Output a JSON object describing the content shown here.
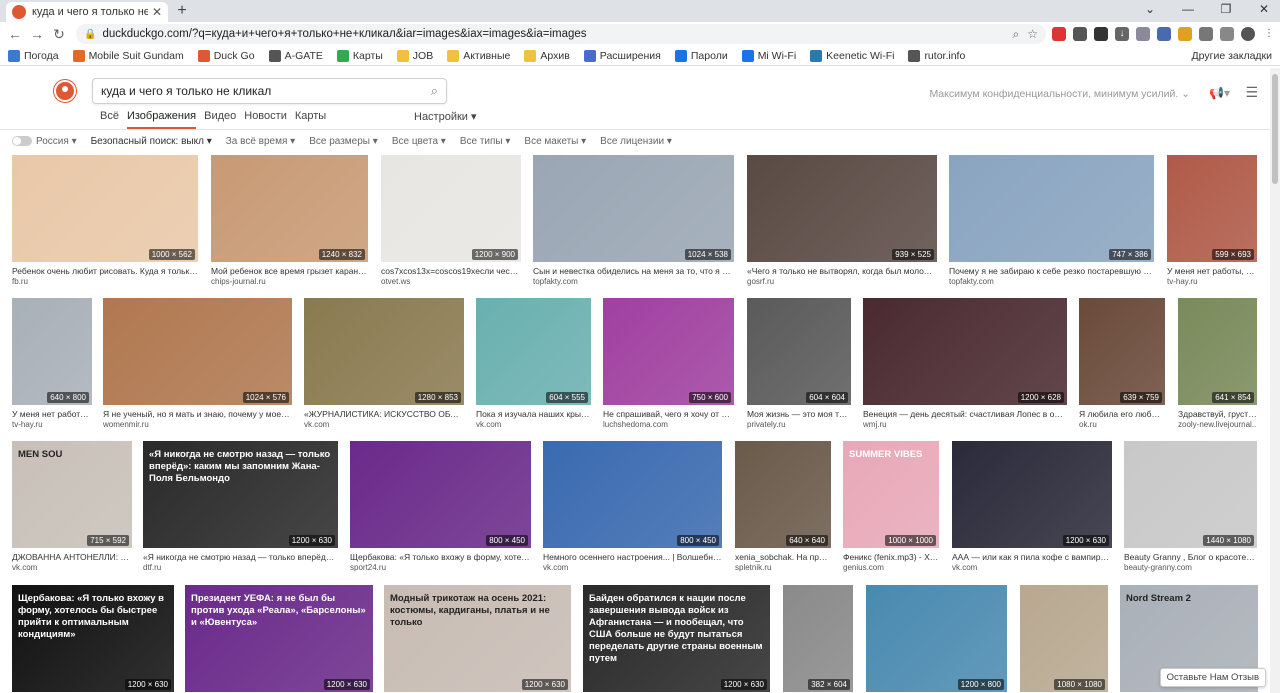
{
  "browser": {
    "tab_title": "куда и чего я только не кликал",
    "url": "duckduckgo.com/?q=куда+и+чего+я+только+не+кликал&iar=images&iax=images&ia=images",
    "bookmarks": [
      "Погода",
      "Mobile Suit Gundam",
      "Duck Go",
      "A-GATE",
      "Карты",
      "JOB",
      "Активные",
      "Архив",
      "Расширения",
      "Пароли",
      "Mi Wi-Fi",
      "Keenetic Wi-Fi",
      "rutor.info"
    ],
    "other_bookmarks": "Другие закладки"
  },
  "search": {
    "query": "куда и чего я только не кликал",
    "tabs": [
      "Всё",
      "Изображения",
      "Видео",
      "Новости",
      "Карты"
    ],
    "active_tab": "Изображения",
    "settings": "Настройки",
    "privacy_slogan": "Максимум конфиденциальности, минимум усилий."
  },
  "filters": {
    "region": "Россия",
    "safe_search": "Безопасный поиск: выкл",
    "items": [
      "За всё время",
      "Все размеры",
      "Все цвета",
      "Все типы",
      "Все макеты",
      "Все лицензии"
    ]
  },
  "results": [
    {
      "cap": "Ребенок очень любит рисовать. Куда я только не...",
      "src": "fb.ru",
      "size": "1000 × 562",
      "color": "#e9c8a8"
    },
    {
      "cap": "Мой ребенок все время грызет каранда...",
      "src": "chips-journal.ru",
      "size": "1240 × 832",
      "color": "#c89a74"
    },
    {
      "cap": "cos7xcos13x=coscos19xесли честно ...",
      "src": "otvet.ws",
      "size": "1200 × 900",
      "color": "#e8e6e2"
    },
    {
      "cap": "Сын и невестка обиделись на меня за то, что я не от...",
      "src": "topfakty.com",
      "size": "1024 × 538",
      "color": "#9aa6b4"
    },
    {
      "cap": "«Чего я только не вытворял, когда был молодым»...",
      "src": "gosrf.ru",
      "size": "939 × 525",
      "color": "#5a4a44"
    },
    {
      "cap": "Почему я не забираю к себе резко постаревшую род...",
      "src": "topfakty.com",
      "size": "747 × 386",
      "color": "#8aa4c0"
    },
    {
      "cap": "У меня нет работы, дв...",
      "src": "tv-hay.ru",
      "size": "599 × 693",
      "color": "#b05a48"
    },
    {
      "cap": "У меня нет работы, ...",
      "src": "tv-hay.ru",
      "size": "640 × 800",
      "color": "#a8b0b8"
    },
    {
      "cap": "Я не ученый, но я мать и знаю, почему у моего с...",
      "src": "womenmir.ru",
      "size": "1024 × 576",
      "color": "#b07850"
    },
    {
      "cap": "«ЖУРНАЛИСТИКА: ИСКУССТВО ОБЪЯС...",
      "src": "vk.com",
      "size": "1280 × 853",
      "color": "#8a7a50"
    },
    {
      "cap": "Пока я изучала наших крымс...",
      "src": "vk.com",
      "size": "604 × 555",
      "color": "#6ab0b0"
    },
    {
      "cap": "Не спрашивай, чего я хочу от жиз...",
      "src": "luchshedoma.com",
      "size": "750 × 600",
      "color": "#a040a0"
    },
    {
      "cap": "Моя жизнь — это моя терр...",
      "src": "privately.ru",
      "size": "604 × 604",
      "color": "#5a5a5a"
    },
    {
      "cap": "Венеция — день десятый: счастливая Лопес в объят...",
      "src": "wmj.ru",
      "size": "1200 × 628",
      "color": "#4a2a30"
    },
    {
      "cap": "Я любила его любым,...",
      "src": "ok.ru",
      "size": "639 × 759",
      "color": "#6a4a3a"
    },
    {
      "cap": "Здравствуй, грусть...",
      "src": "zooly-new.livejournal...",
      "size": "641 × 854",
      "color": "#7a8a5a"
    },
    {
      "cap": "ДЖОВАННА АНТОНЕЛЛИ: «С...",
      "src": "vk.com",
      "size": "715 × 592",
      "color": "#c8c0b8",
      "overlay": "MEN SOU"
    },
    {
      "cap": "«Я никогда не смотрю назад — только вперёд»: ка...",
      "src": "dtf.ru",
      "size": "1200 × 630",
      "color": "#2a2a2a",
      "overlay": "«Я никогда не смотрю назад — только вперёд»: каким мы запомним Жана-Поля Бельмондо"
    },
    {
      "cap": "Щербакова: «Я только вхожу в форму, хотелос...",
      "src": "sport24.ru",
      "size": "800 × 450",
      "color": "#6a2a8a"
    },
    {
      "cap": "Немного осеннего настроения... | Волшебный ...",
      "src": "vk.com",
      "size": "800 × 450",
      "color": "#3a6ab0"
    },
    {
      "cap": "xenia_sobchak. На прем...",
      "src": "spletnik.ru",
      "size": "640 × 640",
      "color": "#6a5a4a"
    },
    {
      "cap": "Феникс (fenix.mp3) - Хот...",
      "src": "genius.com",
      "size": "1000 × 1000",
      "color": "#e8a8b8",
      "overlay": "SUMMER VIBES"
    },
    {
      "cap": "ААА — или как я пила кофе с вампирами...",
      "src": "vk.com",
      "size": "1200 × 630",
      "color": "#2a2a3a"
    },
    {
      "cap": "Beauty Granny , Блог о красоте и н...",
      "src": "beauty-granny.com",
      "size": "1440 × 1080",
      "color": "#c8c8c8"
    },
    {
      "cap": "",
      "src": "",
      "size": "1200 × 630",
      "color": "#111111",
      "overlay": "Щербакова: «Я только вхожу в форму, хотелось бы быстрее прийти к оптимальным кондициям»"
    },
    {
      "cap": "",
      "src": "",
      "size": "1200 × 630",
      "color": "#6a2a8a",
      "overlay": "Президент УЕФА: я не был бы против ухода «Реала», «Барселоны» и «Ювентуса»"
    },
    {
      "cap": "",
      "src": "",
      "size": "1200 × 630",
      "color": "#c8bcb4",
      "overlay": "Модный трикотаж на осень 2021: костюмы, кардиганы, платья и не только"
    },
    {
      "cap": "",
      "src": "",
      "size": "1200 × 630",
      "color": "#2a2a2a",
      "overlay": "Байден обратился к нации после завершения вывода войск из Афганистана — и пообещал, что США больше не будут пытаться переделать другие страны военным путем"
    },
    {
      "cap": "",
      "src": "",
      "size": "382 × 604",
      "color": "#8a8a8a"
    },
    {
      "cap": "",
      "src": "",
      "size": "1200 × 800",
      "color": "#4a8ab0"
    },
    {
      "cap": "",
      "src": "",
      "size": "1080 × 1080",
      "color": "#b8a890"
    },
    {
      "cap": "",
      "src": "",
      "size": "",
      "color": "#aab0b8",
      "overlay": "Nord Stream 2"
    }
  ],
  "feedback": "Оставьте Нам Отзыв"
}
